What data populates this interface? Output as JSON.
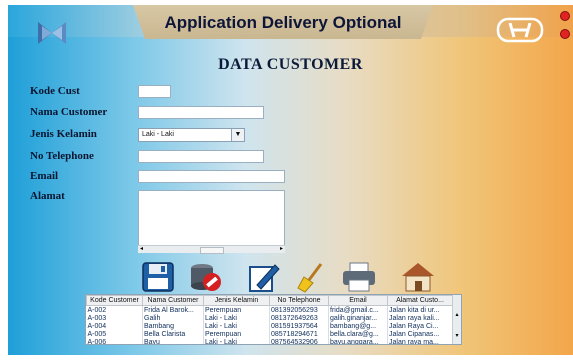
{
  "app": {
    "title": "Application Delivery Optional"
  },
  "window": {
    "icons": [
      "minimize-icon",
      "close-icon"
    ]
  },
  "page": {
    "heading": "DATA CUSTOMER"
  },
  "form": {
    "kode_cust_label": "Kode Cust",
    "kode_cust_value": "",
    "nama_customer_label": "Nama Customer",
    "nama_customer_value": "",
    "jenis_kelamin_label": "Jenis Kelamin",
    "jenis_kelamin_value": "Laki - Laki",
    "no_telephone_label": "No Telephone",
    "no_telephone_value": "",
    "email_label": "Email",
    "email_value": "",
    "alamat_label": "Alamat",
    "alamat_value": ""
  },
  "toolbar": {
    "icons": [
      "save-icon",
      "delete-icon",
      "edit-icon",
      "clear-icon",
      "print-icon",
      "home-icon"
    ]
  },
  "table": {
    "columns": [
      "Kode Customer",
      "Nama Customer",
      "Jenis Kelamin",
      "No Telephone",
      "Email",
      "Alamat Custo..."
    ],
    "rows": [
      [
        "A-002",
        "Frida Al Barok...",
        "Perempuan",
        "081392056293",
        "frida@gmail.c...",
        "Jalan kita di ur..."
      ],
      [
        "A-003",
        "Galih",
        "Laki - Laki",
        "081372649263",
        "galih.ginanjar...",
        "Jalan raya kali..."
      ],
      [
        "A-004",
        "Bambang",
        "Laki - Laki",
        "081591937564",
        "bambang@g...",
        "Jalan Raya Ci..."
      ],
      [
        "A-005",
        "Bella Clarista",
        "Perempuan",
        "085718294671",
        "bella.clara@g...",
        "Jalan Cipanas..."
      ],
      [
        "A-006",
        "Bayu",
        "Laki - Laki",
        "087564532906",
        "bayu.anggara...",
        "Jalan raya ma..."
      ]
    ]
  },
  "colors": {
    "title_text": "#0d1538",
    "label_text": "#0a1530",
    "background_left": "#1e9fd8",
    "background_right": "#f3a64a"
  }
}
